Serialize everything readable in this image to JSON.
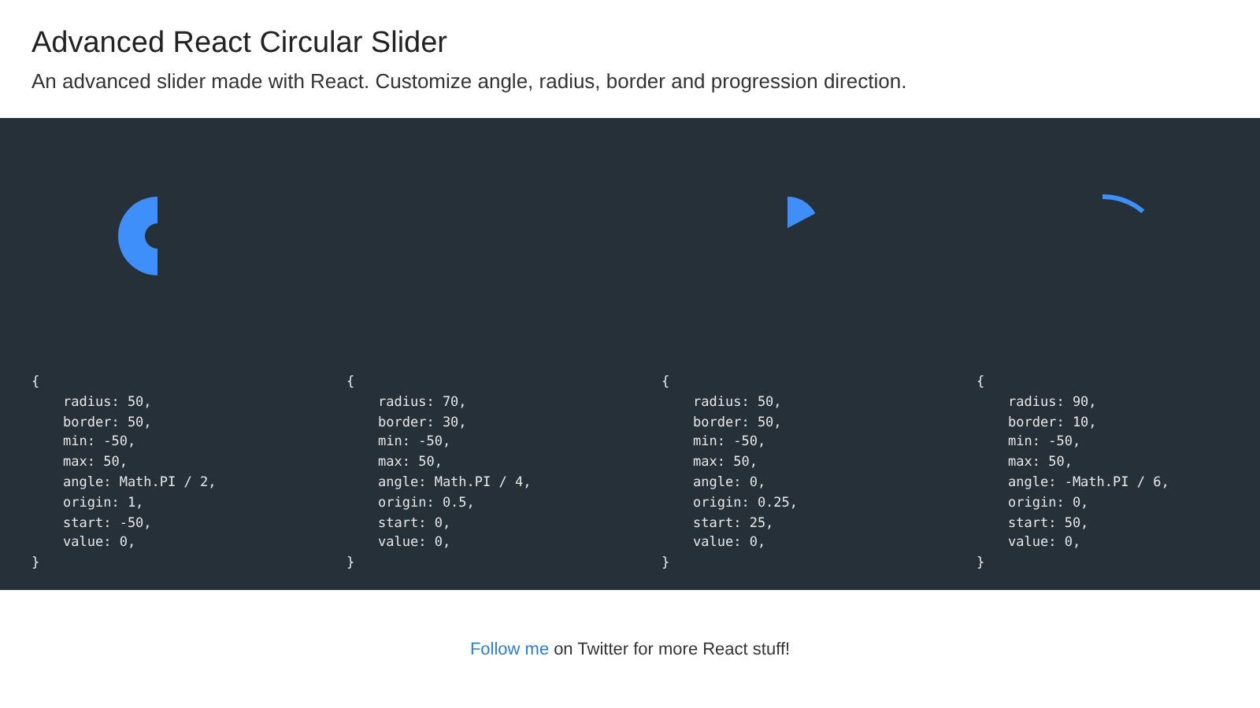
{
  "header": {
    "title": "Advanced React Circular Slider",
    "subtitle": "An advanced slider made with React. Customize angle, radius, border and progression direction."
  },
  "demos": [
    {
      "code_lines": [
        "{",
        "radius: 50,",
        "border: 50,",
        "min: -50,",
        "max: 50,",
        "angle: Math.PI / 2,",
        "origin: 1,",
        "start: -50,",
        "value: 0,",
        "}"
      ]
    },
    {
      "code_lines": [
        "{",
        "radius: 70,",
        "border: 30,",
        "min: -50,",
        "max: 50,",
        "angle: Math.PI / 4,",
        "origin: 0.5,",
        "start: 0,",
        "value: 0,",
        "}"
      ]
    },
    {
      "code_lines": [
        "{",
        "radius: 50,",
        "border: 50,",
        "min: -50,",
        "max: 50,",
        "angle: 0,",
        "origin: 0.25,",
        "start: 25,",
        "value: 0,",
        "}"
      ]
    },
    {
      "code_lines": [
        "{",
        "radius: 90,",
        "border: 10,",
        "min: -50,",
        "max: 50,",
        "angle: -Math.PI / 6,",
        "origin: 0,",
        "start: 50,",
        "value: 0,",
        "}"
      ]
    }
  ],
  "footer": {
    "link": "Follow me",
    "text": "on Twitter for more React stuff!"
  }
}
